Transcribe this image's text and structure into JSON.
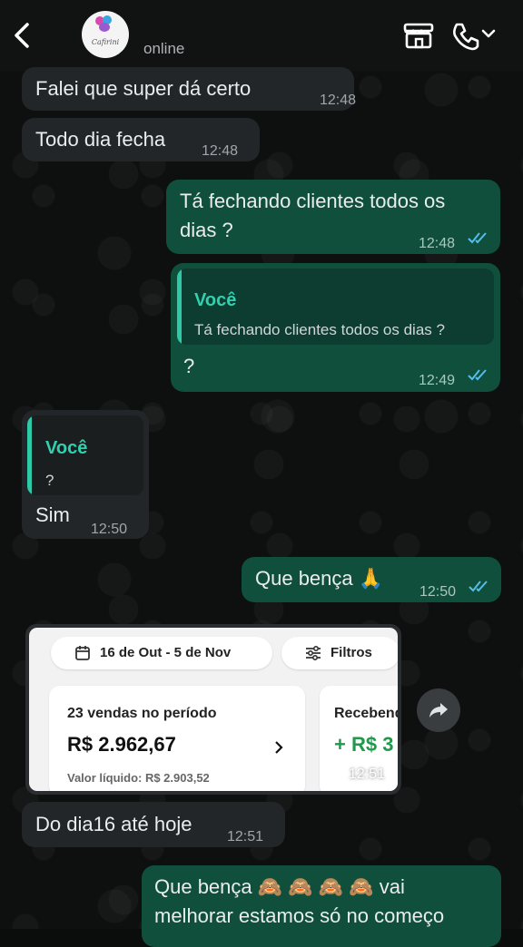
{
  "header": {
    "status": "online",
    "avatar_text": "Cafirini",
    "icons": [
      "back-arrow-icon",
      "shop-icon",
      "phone-icon",
      "chevron-down-icon"
    ]
  },
  "messages": [
    {
      "dir": "in",
      "text": "Falei que super dá certo",
      "time": "12:48"
    },
    {
      "dir": "in",
      "text": "Todo dia fecha",
      "time": "12:48"
    },
    {
      "dir": "out",
      "line1": "Tá fechando clientes todos os",
      "line2": "dias ?",
      "time": "12:48"
    },
    {
      "dir": "out",
      "quote_author": "Você",
      "quote_text": "Tá fechando clientes todos os dias ?",
      "text": "?",
      "time": "12:49"
    },
    {
      "dir": "in",
      "quote_author": "Você",
      "quote_text": "?",
      "text": "Sim",
      "time": "12:50"
    },
    {
      "dir": "out",
      "text": "Que bença 🙏",
      "time": "12:50"
    },
    {
      "dir": "in",
      "text": "Do dia16 até hoje",
      "time": "12:51"
    },
    {
      "dir": "out",
      "line1": "Que bença 🙈 🙈 🙈 🙈  vai",
      "line2": "melhorar estamos só no começo"
    }
  ],
  "screenshot_card": {
    "date_range": "16 de Out - 5 de Nov",
    "filters_label": "Filtros",
    "sales_title": "23 vendas no período",
    "sales_amount": "R$ 2.962,67",
    "net_value": "Valor líquido: R$ 2.903,52",
    "receivable_title": "Recebendo",
    "receivable_amount": "+ R$ 3",
    "time": "12:51"
  },
  "colors": {
    "incoming_bubble": "#232628",
    "outgoing_bubble": "#114f3d",
    "quote_accent": "#2ec9a6",
    "read_ticks": "#53bdeb",
    "green_amount": "#1f9a4b"
  }
}
